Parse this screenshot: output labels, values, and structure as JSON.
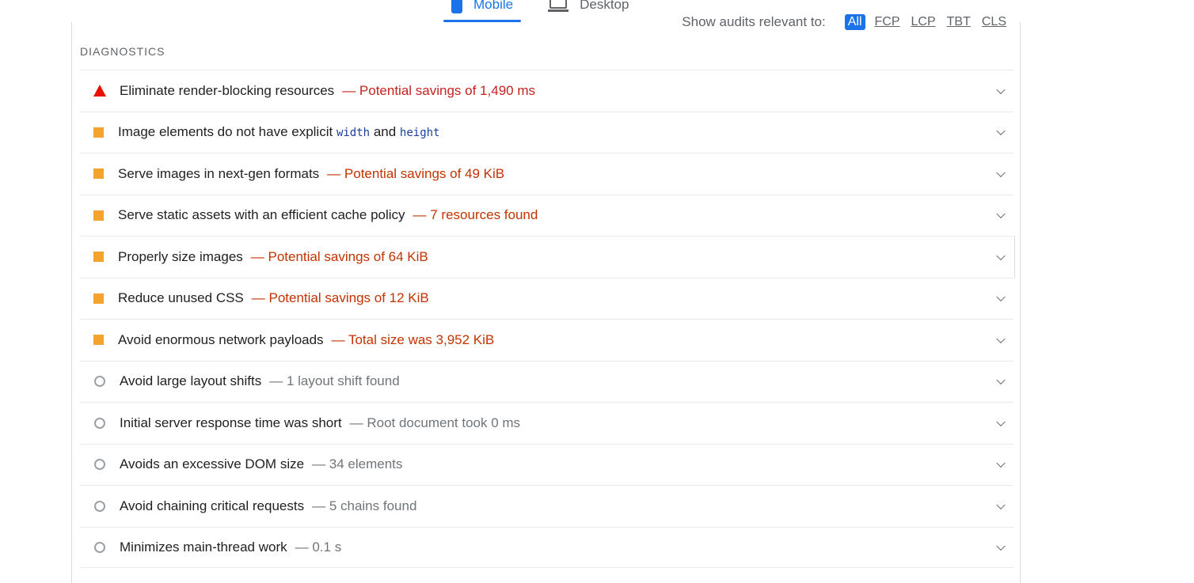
{
  "device_tabs": [
    {
      "label": "Mobile",
      "icon": "phone-icon",
      "active": true
    },
    {
      "label": "Desktop",
      "icon": "laptop-icon",
      "active": false
    }
  ],
  "filter": {
    "label": "Show audits relevant to:",
    "chips": [
      "All",
      "FCP",
      "LCP",
      "TBT",
      "CLS"
    ],
    "active": "All"
  },
  "section_title": "DIAGNOSTICS",
  "audits": [
    {
      "status": "fail",
      "icon": "triangle-warning-icon",
      "title": "Eliminate render-blocking resources",
      "detail": "— Potential savings of 1,490 ms"
    },
    {
      "status": "average",
      "icon": "orange-square-icon",
      "title_parts": [
        "Image elements do not have explicit ",
        "width",
        " and ",
        "height"
      ],
      "detail": ""
    },
    {
      "status": "average",
      "icon": "orange-square-icon",
      "title": "Serve images in next-gen formats",
      "detail": "— Potential savings of 49 KiB"
    },
    {
      "status": "average",
      "icon": "orange-square-icon",
      "title": "Serve static assets with an efficient cache policy",
      "detail": "— 7 resources found"
    },
    {
      "status": "average",
      "icon": "orange-square-icon",
      "title": "Properly size images",
      "detail": "— Potential savings of 64 KiB"
    },
    {
      "status": "average",
      "icon": "orange-square-icon",
      "title": "Reduce unused CSS",
      "detail": "— Potential savings of 12 KiB"
    },
    {
      "status": "average",
      "icon": "orange-square-icon",
      "title": "Avoid enormous network payloads",
      "detail": "— Total size was 3,952 KiB"
    },
    {
      "status": "info",
      "icon": "grey-circle-icon",
      "title": "Avoid large layout shifts",
      "detail": "— 1 layout shift found"
    },
    {
      "status": "info",
      "icon": "grey-circle-icon",
      "title": "Initial server response time was short",
      "detail": "— Root document took 0 ms"
    },
    {
      "status": "info",
      "icon": "grey-circle-icon",
      "title": "Avoids an excessive DOM size",
      "detail": "— 34 elements"
    },
    {
      "status": "info",
      "icon": "grey-circle-icon",
      "title": "Avoid chaining critical requests",
      "detail": "— 5 chains found"
    },
    {
      "status": "info",
      "icon": "grey-circle-icon",
      "title": "Minimizes main-thread work",
      "detail": "— 0.1 s"
    }
  ],
  "colors": {
    "accent": "#1a73e8",
    "fail": "#eb0f00",
    "average": "#f4a32f",
    "info": "#9aa0a6"
  }
}
